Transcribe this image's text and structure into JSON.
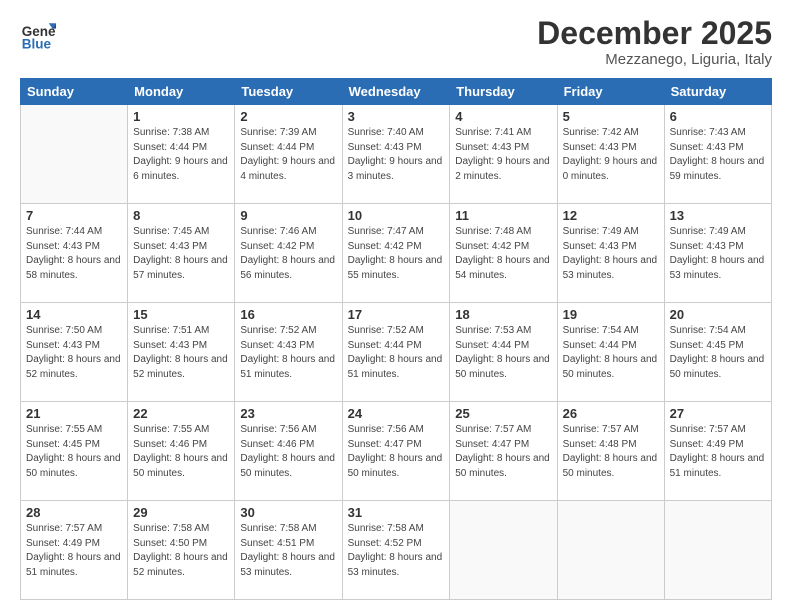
{
  "logo": {
    "general": "General",
    "blue": "Blue"
  },
  "title": "December 2025",
  "location": "Mezzanego, Liguria, Italy",
  "headers": [
    "Sunday",
    "Monday",
    "Tuesday",
    "Wednesday",
    "Thursday",
    "Friday",
    "Saturday"
  ],
  "weeks": [
    [
      {
        "day": "",
        "sunrise": "",
        "sunset": "",
        "daylight": ""
      },
      {
        "day": "1",
        "sunrise": "Sunrise: 7:38 AM",
        "sunset": "Sunset: 4:44 PM",
        "daylight": "Daylight: 9 hours and 6 minutes."
      },
      {
        "day": "2",
        "sunrise": "Sunrise: 7:39 AM",
        "sunset": "Sunset: 4:44 PM",
        "daylight": "Daylight: 9 hours and 4 minutes."
      },
      {
        "day": "3",
        "sunrise": "Sunrise: 7:40 AM",
        "sunset": "Sunset: 4:43 PM",
        "daylight": "Daylight: 9 hours and 3 minutes."
      },
      {
        "day": "4",
        "sunrise": "Sunrise: 7:41 AM",
        "sunset": "Sunset: 4:43 PM",
        "daylight": "Daylight: 9 hours and 2 minutes."
      },
      {
        "day": "5",
        "sunrise": "Sunrise: 7:42 AM",
        "sunset": "Sunset: 4:43 PM",
        "daylight": "Daylight: 9 hours and 0 minutes."
      },
      {
        "day": "6",
        "sunrise": "Sunrise: 7:43 AM",
        "sunset": "Sunset: 4:43 PM",
        "daylight": "Daylight: 8 hours and 59 minutes."
      }
    ],
    [
      {
        "day": "7",
        "sunrise": "Sunrise: 7:44 AM",
        "sunset": "Sunset: 4:43 PM",
        "daylight": "Daylight: 8 hours and 58 minutes."
      },
      {
        "day": "8",
        "sunrise": "Sunrise: 7:45 AM",
        "sunset": "Sunset: 4:43 PM",
        "daylight": "Daylight: 8 hours and 57 minutes."
      },
      {
        "day": "9",
        "sunrise": "Sunrise: 7:46 AM",
        "sunset": "Sunset: 4:42 PM",
        "daylight": "Daylight: 8 hours and 56 minutes."
      },
      {
        "day": "10",
        "sunrise": "Sunrise: 7:47 AM",
        "sunset": "Sunset: 4:42 PM",
        "daylight": "Daylight: 8 hours and 55 minutes."
      },
      {
        "day": "11",
        "sunrise": "Sunrise: 7:48 AM",
        "sunset": "Sunset: 4:42 PM",
        "daylight": "Daylight: 8 hours and 54 minutes."
      },
      {
        "day": "12",
        "sunrise": "Sunrise: 7:49 AM",
        "sunset": "Sunset: 4:43 PM",
        "daylight": "Daylight: 8 hours and 53 minutes."
      },
      {
        "day": "13",
        "sunrise": "Sunrise: 7:49 AM",
        "sunset": "Sunset: 4:43 PM",
        "daylight": "Daylight: 8 hours and 53 minutes."
      }
    ],
    [
      {
        "day": "14",
        "sunrise": "Sunrise: 7:50 AM",
        "sunset": "Sunset: 4:43 PM",
        "daylight": "Daylight: 8 hours and 52 minutes."
      },
      {
        "day": "15",
        "sunrise": "Sunrise: 7:51 AM",
        "sunset": "Sunset: 4:43 PM",
        "daylight": "Daylight: 8 hours and 52 minutes."
      },
      {
        "day": "16",
        "sunrise": "Sunrise: 7:52 AM",
        "sunset": "Sunset: 4:43 PM",
        "daylight": "Daylight: 8 hours and 51 minutes."
      },
      {
        "day": "17",
        "sunrise": "Sunrise: 7:52 AM",
        "sunset": "Sunset: 4:44 PM",
        "daylight": "Daylight: 8 hours and 51 minutes."
      },
      {
        "day": "18",
        "sunrise": "Sunrise: 7:53 AM",
        "sunset": "Sunset: 4:44 PM",
        "daylight": "Daylight: 8 hours and 50 minutes."
      },
      {
        "day": "19",
        "sunrise": "Sunrise: 7:54 AM",
        "sunset": "Sunset: 4:44 PM",
        "daylight": "Daylight: 8 hours and 50 minutes."
      },
      {
        "day": "20",
        "sunrise": "Sunrise: 7:54 AM",
        "sunset": "Sunset: 4:45 PM",
        "daylight": "Daylight: 8 hours and 50 minutes."
      }
    ],
    [
      {
        "day": "21",
        "sunrise": "Sunrise: 7:55 AM",
        "sunset": "Sunset: 4:45 PM",
        "daylight": "Daylight: 8 hours and 50 minutes."
      },
      {
        "day": "22",
        "sunrise": "Sunrise: 7:55 AM",
        "sunset": "Sunset: 4:46 PM",
        "daylight": "Daylight: 8 hours and 50 minutes."
      },
      {
        "day": "23",
        "sunrise": "Sunrise: 7:56 AM",
        "sunset": "Sunset: 4:46 PM",
        "daylight": "Daylight: 8 hours and 50 minutes."
      },
      {
        "day": "24",
        "sunrise": "Sunrise: 7:56 AM",
        "sunset": "Sunset: 4:47 PM",
        "daylight": "Daylight: 8 hours and 50 minutes."
      },
      {
        "day": "25",
        "sunrise": "Sunrise: 7:57 AM",
        "sunset": "Sunset: 4:47 PM",
        "daylight": "Daylight: 8 hours and 50 minutes."
      },
      {
        "day": "26",
        "sunrise": "Sunrise: 7:57 AM",
        "sunset": "Sunset: 4:48 PM",
        "daylight": "Daylight: 8 hours and 50 minutes."
      },
      {
        "day": "27",
        "sunrise": "Sunrise: 7:57 AM",
        "sunset": "Sunset: 4:49 PM",
        "daylight": "Daylight: 8 hours and 51 minutes."
      }
    ],
    [
      {
        "day": "28",
        "sunrise": "Sunrise: 7:57 AM",
        "sunset": "Sunset: 4:49 PM",
        "daylight": "Daylight: 8 hours and 51 minutes."
      },
      {
        "day": "29",
        "sunrise": "Sunrise: 7:58 AM",
        "sunset": "Sunset: 4:50 PM",
        "daylight": "Daylight: 8 hours and 52 minutes."
      },
      {
        "day": "30",
        "sunrise": "Sunrise: 7:58 AM",
        "sunset": "Sunset: 4:51 PM",
        "daylight": "Daylight: 8 hours and 53 minutes."
      },
      {
        "day": "31",
        "sunrise": "Sunrise: 7:58 AM",
        "sunset": "Sunset: 4:52 PM",
        "daylight": "Daylight: 8 hours and 53 minutes."
      },
      {
        "day": "",
        "sunrise": "",
        "sunset": "",
        "daylight": ""
      },
      {
        "day": "",
        "sunrise": "",
        "sunset": "",
        "daylight": ""
      },
      {
        "day": "",
        "sunrise": "",
        "sunset": "",
        "daylight": ""
      }
    ]
  ]
}
